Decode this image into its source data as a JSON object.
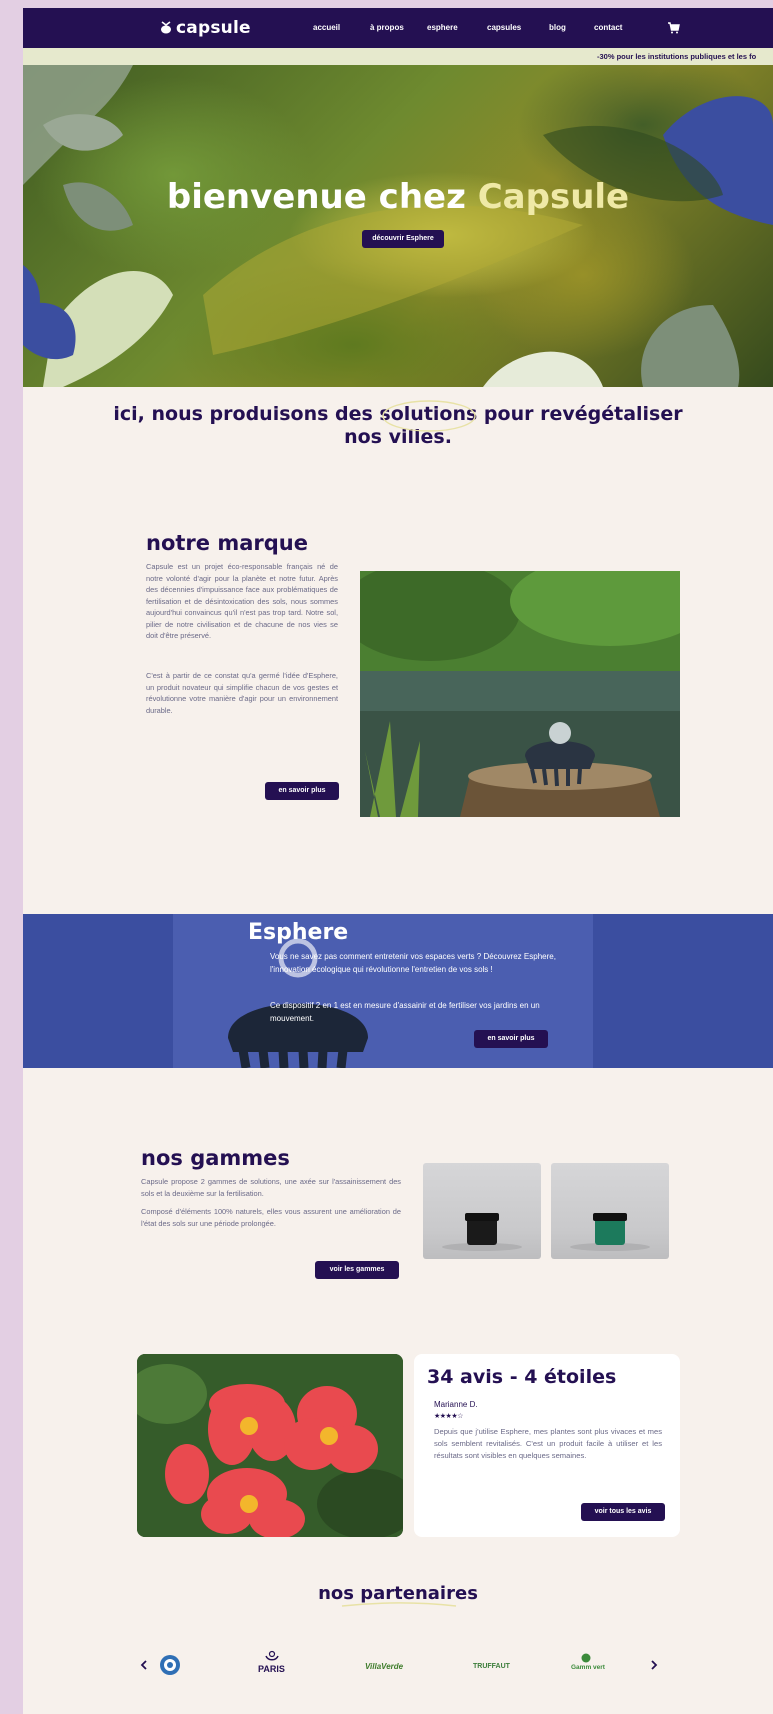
{
  "brand": {
    "name": "capsule"
  },
  "nav": {
    "items": [
      "accueil",
      "à propos",
      "esphere",
      "capsules",
      "blog",
      "contact"
    ],
    "cart_icon": "cart-icon"
  },
  "promo": {
    "text": "-30% pour les institutions publiques et les fo"
  },
  "hero": {
    "title_main": "bienvenue chez ",
    "title_brand": "Capsule",
    "button": "découvrir Esphere"
  },
  "headline": {
    "line1": "ici, nous produisons des solutions pour revégétaliser",
    "line2": "nos villes."
  },
  "brand_section": {
    "title": "notre marque",
    "paragraph1": "Capsule est un projet éco-responsable français né de notre volonté d'agir pour la planète et notre futur. Après des décennies d'impuissance face aux problématiques de fertilisation et de désintoxication des sols, nous sommes aujourd'hui convaincus qu'il n'est pas trop tard. Notre sol, pilier de notre civilisation et de chacune de nos vies se doit d'être préservé.",
    "paragraph2": "C'est à partir de ce constat qu'a germé l'idée d'Esphere, un produit novateur qui simplifie chacun de vos gestes et révolutionne votre manière d'agir pour un environnement durable.",
    "button": "en savoir plus"
  },
  "esphere": {
    "title": "Esphere",
    "paragraph1": "Vous ne savez pas comment entretenir vos espaces verts ? Découvrez Esphere, l'innovation écologique qui révolutionne l'entretien de vos sols !",
    "paragraph2": "Ce dispositif 2 en 1 est en mesure d'assainir et de fertiliser vos jardins en un mouvement.",
    "button": "en savoir plus"
  },
  "gammes": {
    "title": "nos gammes",
    "paragraph1": "Capsule propose 2 gammes de solutions, une axée sur l'assainissement des sols et la deuxième sur la fertilisation.",
    "paragraph2": "Composé d'éléments 100% naturels, elles vous assurent une amélioration de l'état des sols sur une période prolongée.",
    "button": "voir les gammes",
    "jar_colors": [
      "#1a1a1a",
      "#1c7a5c"
    ]
  },
  "reviews": {
    "title": "34 avis - 4 étoiles",
    "reviewer": "Marianne D.",
    "stars": "★★★★☆",
    "rating": 4,
    "text": "Depuis que j'utilise Esphere, mes plantes sont plus vivaces et mes sols semblent revitalisés. C'est un produit facile à utiliser et les résultats sont visibles en quelques semaines.",
    "button": "voir tous les avis"
  },
  "partners": {
    "title": "nos partenaires",
    "logos": [
      "PARIS",
      "VillaVerde",
      "TRUFFAUT",
      "Gamm vert"
    ],
    "prev_icon": "chevron-left-icon",
    "next_icon": "chevron-right-icon"
  },
  "colors": {
    "primary": "#241052",
    "accent_blue": "#3b4ea0",
    "bg": "#f7f1ec",
    "promo_bg": "#e6e9cd",
    "side": "#e3cfe3"
  }
}
